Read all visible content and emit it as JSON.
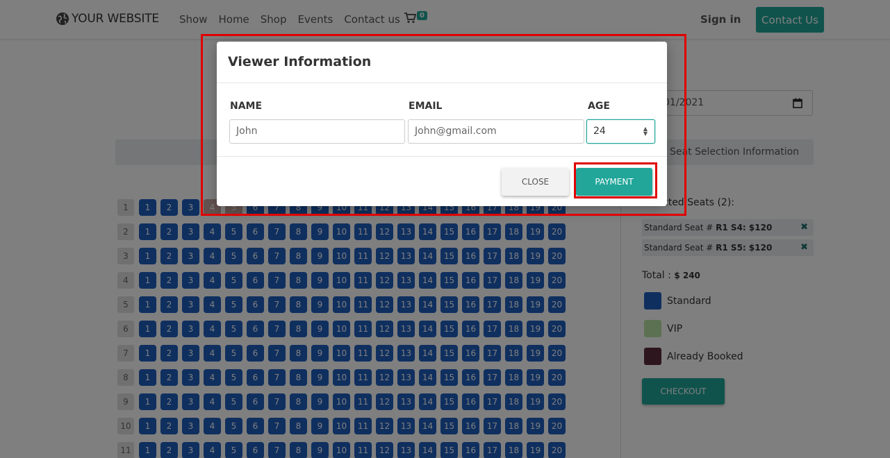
{
  "navbar": {
    "brand": "YOUR WEBSITE",
    "links": [
      "Show",
      "Home",
      "Shop",
      "Events",
      "Contact us"
    ],
    "cart_count": "0",
    "sign_in": "Sign in",
    "contact_button": "Contact Us"
  },
  "page": {
    "date_value": "01/2021",
    "seat_selection_header": "Seat Selection Information",
    "selected_title": "Selected Seats (2):",
    "selected_seats": [
      {
        "prefix": "Standard Seat # ",
        "detail": "R1 S4: $120"
      },
      {
        "prefix": "Standard Seat # ",
        "detail": "R1 S5: $120"
      }
    ],
    "total_label": "Total : ",
    "total_value": "$ 240",
    "legend": [
      {
        "label": "Standard",
        "color": "#1f5fbf"
      },
      {
        "label": "VIP",
        "color": "#b8e3a5"
      },
      {
        "label": "Already Booked",
        "color": "#5a2d3a"
      }
    ],
    "checkout_button": "CHECKOUT",
    "seat_map": {
      "rows": 11,
      "seats_per_row": 20,
      "booked": [
        {
          "row": 1,
          "seat": 4
        },
        {
          "row": 1,
          "seat": 5
        }
      ]
    }
  },
  "modal": {
    "title": "Viewer Information",
    "name_label": "NAME",
    "email_label": "EMAIL",
    "age_label": "AGE",
    "name_value": "John",
    "email_value": "John@gmail.com",
    "age_value": "24",
    "close_button": "CLOSE",
    "payment_button": "PAYMENT"
  },
  "colors": {
    "accent": "#21a699",
    "seat_standard": "#1f5fbf",
    "highlight": "#e00000"
  }
}
